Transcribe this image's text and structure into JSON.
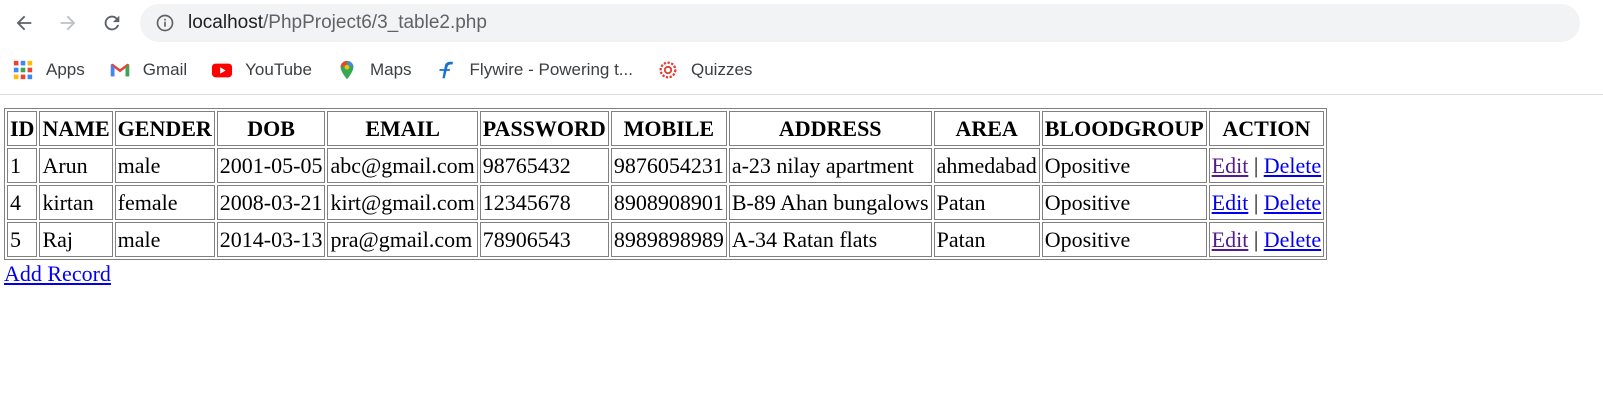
{
  "browser": {
    "url_host": "localhost",
    "url_path": "/PhpProject6/3_table2.php"
  },
  "bookmarks": [
    {
      "label": "Apps",
      "icon": "apps-grid-icon"
    },
    {
      "label": "Gmail",
      "icon": "gmail-icon"
    },
    {
      "label": "YouTube",
      "icon": "youtube-icon"
    },
    {
      "label": "Maps",
      "icon": "maps-icon"
    },
    {
      "label": "Flywire - Powering t...",
      "icon": "flywire-icon"
    },
    {
      "label": "Quizzes",
      "icon": "quizzes-icon"
    }
  ],
  "table": {
    "headers": [
      "ID",
      "NAME",
      "GENDER",
      "DOB",
      "EMAIL",
      "PASSWORD",
      "MOBILE",
      "ADDRESS",
      "AREA",
      "BLOODGROUP",
      "ACTION"
    ],
    "rows": [
      {
        "id": "1",
        "name": "Arun",
        "gender": "male",
        "dob": "2001-05-05",
        "email": "abc@gmail.com",
        "password": "98765432",
        "mobile": "9876054231",
        "address": "a-23 nilay apartment",
        "area": "ahmedabad",
        "bloodgroup": "Opositive",
        "edit": "Edit",
        "sep": "|",
        "delete": "Delete"
      },
      {
        "id": "4",
        "name": "kirtan",
        "gender": "female",
        "dob": "2008-03-21",
        "email": "kirt@gmail.com",
        "password": "12345678",
        "mobile": "8908908901",
        "address": "B-89 Ahan bungalows",
        "area": "Patan",
        "bloodgroup": "Opositive",
        "edit": "Edit",
        "sep": "|",
        "delete": "Delete"
      },
      {
        "id": "5",
        "name": "Raj",
        "gender": "male",
        "dob": "2014-03-13",
        "email": "pra@gmail.com",
        "password": "78906543",
        "mobile": "8989898989",
        "address": "A-34 Ratan flats",
        "area": "Patan",
        "bloodgroup": "Opositive",
        "edit": "Edit",
        "sep": "|",
        "delete": "Delete"
      }
    ]
  },
  "add_record_label": "Add Record",
  "colors": {
    "link": "#0000ee",
    "visited_link": "#551a8b",
    "omnibox_bg": "#f1f3f4"
  }
}
